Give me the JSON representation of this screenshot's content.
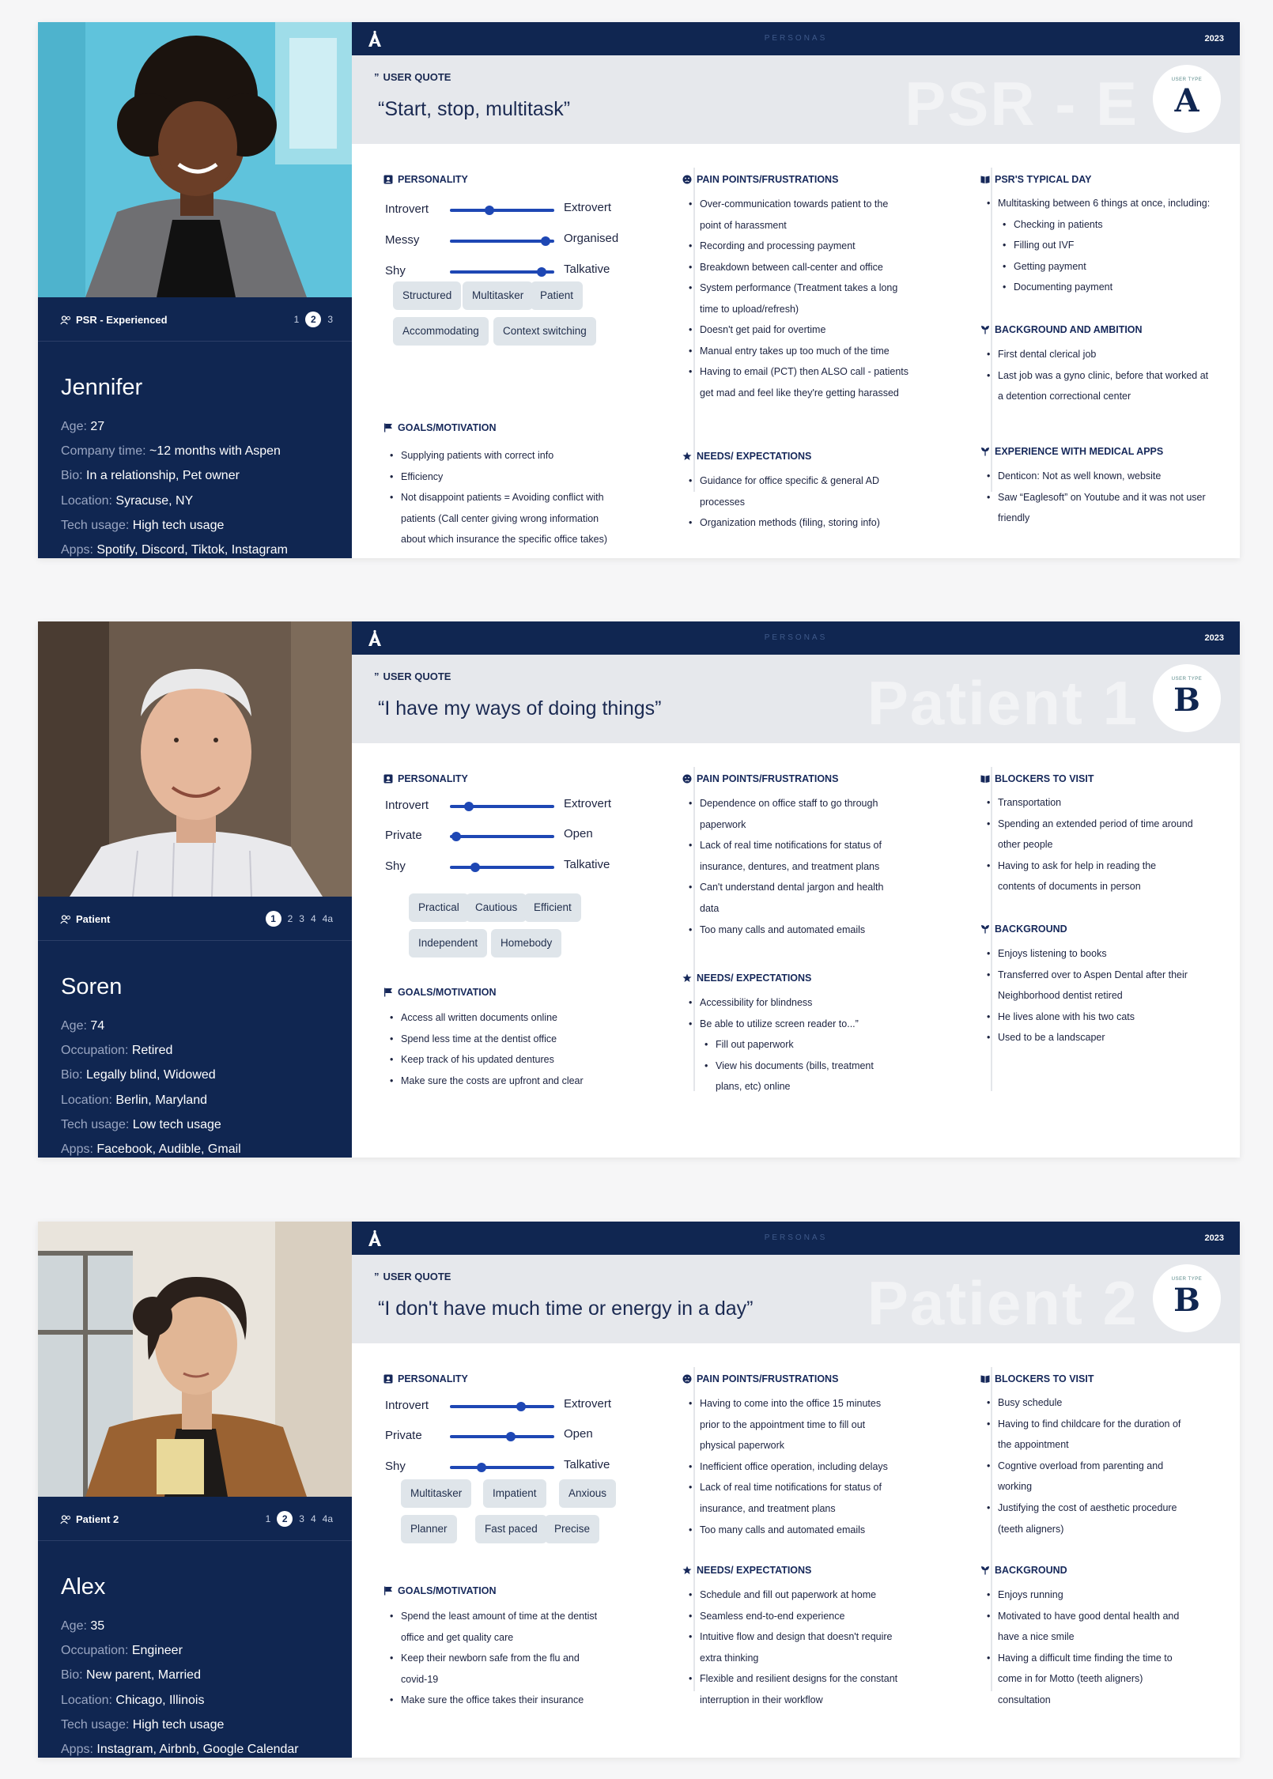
{
  "header": {
    "label": "PERSONAS",
    "year": "2023"
  },
  "personas": [
    {
      "type_label": "PSR - Experienced",
      "pager": {
        "pages": [
          "1",
          "2",
          "3"
        ],
        "current": "2"
      },
      "name": "Jennifer",
      "facts": [
        {
          "k": "Age:",
          "v": "27"
        },
        {
          "k": "Company time:",
          "v": "~12 months with Aspen"
        },
        {
          "k": "Bio:",
          "v": "In a relationship, Pet owner"
        },
        {
          "k": "Location:",
          "v": "Syracuse, NY"
        },
        {
          "k": "Tech usage:",
          "v": "High tech usage"
        },
        {
          "k": "Apps:",
          "v": "Spotify, Discord, Tiktok, Instagram"
        }
      ],
      "quote_label": "USER QUOTE",
      "quote": "“Start, stop, multitask”",
      "ghost": "PSR - E",
      "badge_small": "USER TYPE",
      "badge_letter": "A",
      "personality_title": "PERSONALITY",
      "sliders": [
        {
          "left": "Introvert",
          "right": "Extrovert",
          "value": 0.38
        },
        {
          "left": "Messy",
          "right": "Organised",
          "value": 0.92
        },
        {
          "left": "Shy",
          "right": "Talkative",
          "value": 0.88
        }
      ],
      "traits": [
        "Structured",
        "Multitasker",
        "Patient",
        "Accommodating",
        "Context switching"
      ],
      "goals_title": "GOALS/MOTIVATION",
      "goals": [
        "Supplying patients with correct info",
        "Efficiency",
        "Not disappoint patients = Avoiding conflict with\npatients (Call center giving wrong information\nabout which insurance the specific office takes)"
      ],
      "pain_title": "PAIN POINTS/FRUSTRATIONS",
      "pain": [
        "Over-communication towards patient to the\npoint of harassment",
        "Recording and processing payment",
        "Breakdown between call-center and office",
        "System performance (Treatment takes a long\ntime to upload/refresh)",
        "Doesn't get paid for overtime",
        " Manual entry takes up too much of the time",
        "Having to email (PCT) then ALSO call - patients\nget mad and feel like they're getting harassed"
      ],
      "needs_title": "NEEDS/ EXPECTATIONS",
      "needs": [
        {
          "t": "Guidance for office specific & general AD\nprocesses"
        },
        {
          "t": "Organization methods (filing, storing info)"
        }
      ],
      "c3a_title": "PSR'S TYPICAL DAY",
      "c3a": [
        {
          "t": "Multitasking between 6 things at once, including:"
        },
        {
          "t": "Checking in patients",
          "sub": true
        },
        {
          "t": "Filling out IVF",
          "sub": true
        },
        {
          "t": "Getting payment",
          "sub": true
        },
        {
          "t": "Documenting payment",
          "sub": true
        }
      ],
      "c3b_title": "BACKGROUND AND AMBITION",
      "c3b": [
        "First dental clerical job",
        "Last job was a gyno clinic, before that worked at\na detention correctional center"
      ],
      "c3c_title": "EXPERIENCE WITH MEDICAL APPS",
      "c3c": [
        "Denticon: Not as well known, website",
        "Saw “Eaglesoft” on Youtube and it was not user\nfriendly"
      ]
    },
    {
      "type_label": "Patient",
      "pager": {
        "pages": [
          "1",
          "2",
          "3",
          "4",
          "4a"
        ],
        "current": "1"
      },
      "name": "Soren",
      "facts": [
        {
          "k": "Age:",
          "v": "74"
        },
        {
          "k": "Occupation:",
          "v": "Retired"
        },
        {
          "k": "Bio:",
          "v": "Legally blind, Widowed"
        },
        {
          "k": "Location:",
          "v": "Berlin, Maryland"
        },
        {
          "k": "Tech usage:",
          "v": "Low tech usage"
        },
        {
          "k": "Apps:",
          "v": "Facebook, Audible, Gmail"
        }
      ],
      "quote_label": "USER QUOTE",
      "quote": "“I have my ways of doing things”",
      "ghost": "Patient 1",
      "badge_small": "USER TYPE",
      "badge_letter": "B",
      "personality_title": "PERSONALITY",
      "sliders": [
        {
          "left": "Introvert",
          "right": "Extrovert",
          "value": 0.18
        },
        {
          "left": "Private",
          "right": "Open",
          "value": 0.06
        },
        {
          "left": "Shy",
          "right": "Talkative",
          "value": 0.24
        }
      ],
      "traits": [
        "Practical",
        "Cautious",
        "Efficient",
        "Independent",
        "Homebody"
      ],
      "goals_title": "GOALS/MOTIVATION",
      "goals": [
        "Access all written documents online",
        "Spend less time at the dentist office",
        "Keep track of his updated dentures",
        "Make sure the costs are upfront and clear"
      ],
      "pain_title": "PAIN POINTS/FRUSTRATIONS",
      "pain": [
        "Dependence on office staff to go through\npaperwork",
        "Lack of real time notifications for status of\ninsurance, dentures, and treatment plans",
        "Can't understand dental jargon and health\ndata",
        "Too many calls and automated emails"
      ],
      "needs_title": "NEEDS/ EXPECTATIONS",
      "needs": [
        {
          "t": "Accessibility for blindness"
        },
        {
          "t": "Be able to utilize screen reader to...”"
        },
        {
          "t": "Fill out paperwork",
          "sub": true
        },
        {
          "t": "View his documents (bills, treatment\nplans, etc) online",
          "sub": true
        }
      ],
      "c3a_title": "BLOCKERS TO VISIT",
      "c3a": [
        {
          "t": "Transportation"
        },
        {
          "t": "Spending an extended period of time around\nother people"
        },
        {
          "t": "Having to ask for help in reading the\ncontents of documents in person"
        }
      ],
      "c3b_title": "BACKGROUND",
      "c3b": [
        "Enjoys listening to books",
        "Transferred over to Aspen Dental after their\nNeighborhood dentist retired",
        "He lives alone with his two cats",
        "Used to be a landscaper"
      ],
      "c3c_title": "",
      "c3c": []
    },
    {
      "type_label": "Patient 2",
      "pager": {
        "pages": [
          "1",
          "2",
          "3",
          "4",
          "4a"
        ],
        "current": "2"
      },
      "name": "Alex",
      "facts": [
        {
          "k": "Age:",
          "v": "35"
        },
        {
          "k": "Occupation:",
          "v": "Engineer"
        },
        {
          "k": "Bio:",
          "v": "New parent, Married"
        },
        {
          "k": "Location:",
          "v": "Chicago, Illinois"
        },
        {
          "k": "Tech usage:",
          "v": "High tech usage"
        },
        {
          "k": "Apps:",
          "v": "Instagram, Airbnb, Google Calendar"
        }
      ],
      "quote_label": "USER QUOTE",
      "quote": "“I don't have much time or energy in a day”",
      "ghost": "Patient 2",
      "badge_small": "USER TYPE",
      "badge_letter": "B",
      "personality_title": "PERSONALITY",
      "sliders": [
        {
          "left": "Introvert",
          "right": "Extrovert",
          "value": 0.68
        },
        {
          "left": "Private",
          "right": "Open",
          "value": 0.58
        },
        {
          "left": "Shy",
          "right": "Talkative",
          "value": 0.3
        }
      ],
      "traits": [
        "Multitasker",
        "Impatient",
        "Anxious",
        "Planner",
        "Fast paced",
        "Precise"
      ],
      "goals_title": "GOALS/MOTIVATION",
      "goals": [
        "Spend the least amount of time at the dentist\noffice and get quality care",
        "Keep their newborn safe from the flu and\ncovid-19",
        "Make sure the office takes their insurance"
      ],
      "pain_title": "PAIN POINTS/FRUSTRATIONS",
      "pain": [
        "Having to come into the office 15 minutes\nprior to the appointment time to fill out\nphysical paperwork",
        "Inefficient office operation, including delays",
        "Lack of real time notifications for status of\ninsurance, and treatment plans",
        "Too many calls and automated emails"
      ],
      "needs_title": "NEEDS/ EXPECTATIONS",
      "needs": [
        {
          "t": "Schedule and fill out paperwork at home"
        },
        {
          "t": "Seamless end-to-end experience"
        },
        {
          "t": "Intuitive flow and design that doesn't require\nextra thinking"
        },
        {
          "t": "Flexible and resilient designs for the constant\ninterruption in their workflow"
        }
      ],
      "c3a_title": "BLOCKERS TO VISIT",
      "c3a": [
        {
          "t": "Busy schedule"
        },
        {
          "t": "Having to find childcare for the duration of\nthe appointment"
        },
        {
          "t": "Cogntive overload from parenting and\nworking"
        },
        {
          "t": "Justifying the cost of aesthetic procedure\n(teeth aligners)"
        }
      ],
      "c3b_title": "BACKGROUND",
      "c3b": [
        "Enjoys running",
        "Motivated to have good dental health and\nhave a nice smile",
        "Having a difficult time finding the time to\ncome in for Motto (teeth aligners)\nconsultation"
      ],
      "c3c_title": "",
      "c3c": []
    }
  ]
}
